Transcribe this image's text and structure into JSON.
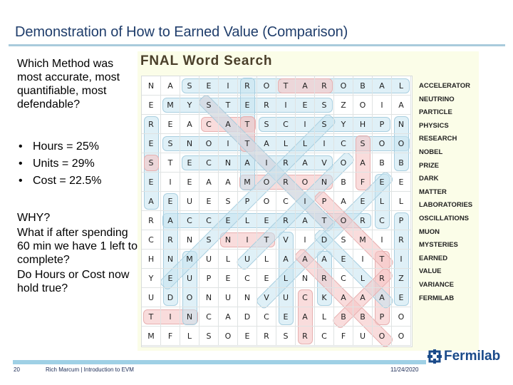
{
  "slide": {
    "title": "Demonstration of How to Earned Value (Comparison)",
    "question": "Which Method was most accurate, most quantifiable, most defendable?",
    "bullets": [
      {
        "marker": "•",
        "text": "Hours = 25%"
      },
      {
        "marker": "•",
        "text": "Units = 29%"
      },
      {
        "marker": "•",
        "text": "Cost = 22.5%"
      }
    ],
    "why_lines": [
      "WHY?",
      "What if after spending 60 min we have 1 left to complete?",
      "Do Hours or Cost now hold true?"
    ]
  },
  "word_search": {
    "title": "FNAL Word Search",
    "grid": [
      [
        "N",
        "A",
        "S",
        "E",
        "I",
        "R",
        "O",
        "T",
        "A",
        "R",
        "O",
        "B",
        "A",
        "L"
      ],
      [
        "E",
        "M",
        "Y",
        "S",
        "T",
        "E",
        "R",
        "I",
        "E",
        "S",
        "Z",
        "O",
        "I",
        "A"
      ],
      [
        "R",
        "E",
        "A",
        "C",
        "A",
        "T",
        "S",
        "C",
        "I",
        "S",
        "Y",
        "H",
        "P",
        "N"
      ],
      [
        "E",
        "S",
        "N",
        "O",
        "I",
        "T",
        "A",
        "L",
        "L",
        "I",
        "C",
        "S",
        "O",
        "O"
      ],
      [
        "S",
        "T",
        "E",
        "C",
        "N",
        "A",
        "I",
        "R",
        "A",
        "V",
        "O",
        "A",
        "B",
        "B"
      ],
      [
        "E",
        "I",
        "E",
        "A",
        "A",
        "M",
        "O",
        "R",
        "O",
        "N",
        "B",
        "F",
        "E",
        "E"
      ],
      [
        "A",
        "E",
        "U",
        "E",
        "S",
        "P",
        "O",
        "C",
        "I",
        "P",
        "A",
        "E",
        "L",
        "L"
      ],
      [
        "R",
        "A",
        "C",
        "C",
        "E",
        "L",
        "E",
        "R",
        "A",
        "T",
        "O",
        "R",
        "C",
        "P"
      ],
      [
        "C",
        "R",
        "N",
        "S",
        "N",
        "I",
        "T",
        "V",
        "I",
        "D",
        "S",
        "M",
        "I",
        "R"
      ],
      [
        "H",
        "N",
        "M",
        "U",
        "L",
        "U",
        "L",
        "A",
        "A",
        "A",
        "E",
        "I",
        "T",
        "I"
      ],
      [
        "Y",
        "E",
        "U",
        "P",
        "E",
        "C",
        "E",
        "L",
        "N",
        "R",
        "C",
        "L",
        "R",
        "Z"
      ],
      [
        "U",
        "D",
        "O",
        "N",
        "U",
        "N",
        "V",
        "U",
        "C",
        "K",
        "A",
        "A",
        "A",
        "E"
      ],
      [
        "T",
        "I",
        "N",
        "C",
        "A",
        "D",
        "C",
        "E",
        "A",
        "L",
        "B",
        "B",
        "P",
        "O"
      ],
      [
        "M",
        "F",
        "L",
        "S",
        "O",
        "E",
        "R",
        "S",
        "R",
        "C",
        "F",
        "U",
        "O",
        "O"
      ]
    ],
    "words": [
      "ACCELERATOR",
      "NEUTRINO",
      "PARTICLE",
      "PHYSICS",
      "RESEARCH",
      "NOBEL",
      "PRIZE",
      "DARK",
      "MATTER",
      "LABORATORIES",
      "OSCILLATIONS",
      "MUON",
      "MYSTERIES",
      "EARNED",
      "VALUE",
      "VARIANCE",
      "FERMILAB"
    ]
  },
  "footer": {
    "page_number": "20",
    "presenter": "Rich Marcum | Introduction to EVM",
    "date": "11/24/2020",
    "logo_text": "Fermilab"
  },
  "colors": {
    "title": "#1f3d6b",
    "highlight_blue": "#c4e4f0",
    "highlight_pink": "#f5c4c4",
    "panel_bg": "#fbfde8",
    "logo": "#1a4a8a"
  }
}
